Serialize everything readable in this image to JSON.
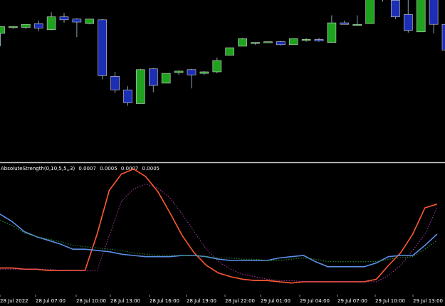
{
  "colors": {
    "background": "#000000",
    "bull": "#1fa31f",
    "bear": "#1c2fb4",
    "wick": "#8aa0b0",
    "separator": "#c8c8c8",
    "strength_line": "#ff5a32",
    "strength_signal": "#b03aa8",
    "weakness_line": "#5b8fe8",
    "weakness_signal": "#2f9a2f",
    "text": "#ffffff"
  },
  "indicator": {
    "name": "AbsoluteStrength(0,10,5,5,,3)",
    "values": [
      "0.0007",
      "0.0005",
      "0.0007",
      "0.0005"
    ]
  },
  "time_labels": [
    "28 Jul 2022",
    "28 Jul 07:00",
    "28 Jul 10:00",
    "28 Jul 13:00",
    "28 Jul 16:00",
    "28 Jul 19:00",
    "28 Jul 22:00",
    "29 Jul 01:00",
    "29 Jul 04:00",
    "29 Jul 07:00",
    "29 Jul 10:00",
    "29 Jul 13:00"
  ],
  "chart_data": [
    {
      "type": "candlestick",
      "price_range": [
        0,
        100
      ],
      "grid": false,
      "candles": [
        {
          "o": 43,
          "h": 52,
          "l": 26,
          "c": 52
        },
        {
          "o": 51,
          "h": 52,
          "l": 49,
          "c": 52
        },
        {
          "o": 51,
          "h": 54,
          "l": 49,
          "c": 55
        },
        {
          "o": 56,
          "h": 60,
          "l": 46,
          "c": 50
        },
        {
          "o": 48,
          "h": 71,
          "l": 47,
          "c": 65
        },
        {
          "o": 65,
          "h": 70,
          "l": 57,
          "c": 61
        },
        {
          "o": 62,
          "h": 63,
          "l": 38,
          "c": 58
        },
        {
          "o": 56,
          "h": 62,
          "l": 55,
          "c": 62
        },
        {
          "o": 61,
          "h": 62,
          "l": -18,
          "c": -13
        },
        {
          "o": -14,
          "h": -8,
          "l": -36,
          "c": -32
        },
        {
          "o": -32,
          "h": -27,
          "l": -53,
          "c": -49
        },
        {
          "o": -50,
          "h": -4,
          "l": -50,
          "c": -5
        },
        {
          "o": -4,
          "h": -3,
          "l": -35,
          "c": -26
        },
        {
          "o": -23,
          "h": -10,
          "l": -23,
          "c": -10
        },
        {
          "o": -9,
          "h": -6,
          "l": -12,
          "c": -7
        },
        {
          "o": -5,
          "h": -4,
          "l": -30,
          "c": -12
        },
        {
          "o": -10,
          "h": -7,
          "l": -12,
          "c": -8
        },
        {
          "o": -8,
          "h": 11,
          "l": -10,
          "c": 7
        },
        {
          "o": 14,
          "h": 24,
          "l": 14,
          "c": 24
        },
        {
          "o": 26,
          "h": 37,
          "l": 26,
          "c": 36
        },
        {
          "o": 30,
          "h": 31,
          "l": 28,
          "c": 31
        },
        {
          "o": 31,
          "h": 32,
          "l": 30,
          "c": 32
        },
        {
          "o": 32,
          "h": 33,
          "l": 27,
          "c": 28
        },
        {
          "o": 28,
          "h": 36,
          "l": 28,
          "c": 36
        },
        {
          "o": 34,
          "h": 37,
          "l": 32,
          "c": 35
        },
        {
          "o": 35,
          "h": 37,
          "l": 32,
          "c": 33
        },
        {
          "o": 31,
          "h": 67,
          "l": 31,
          "c": 57
        },
        {
          "o": 57,
          "h": 60,
          "l": 55,
          "c": 55
        },
        {
          "o": 55,
          "h": 67,
          "l": 53,
          "c": 55
        },
        {
          "o": 56,
          "h": 100,
          "l": 56,
          "c": 98
        },
        {
          "o": 98,
          "h": 100,
          "l": 85,
          "c": 89
        },
        {
          "o": 87,
          "h": 87,
          "l": 62,
          "c": 65
        },
        {
          "o": 68,
          "h": 90,
          "l": 44,
          "c": 47
        },
        {
          "o": 45,
          "h": 97,
          "l": 45,
          "c": 95
        },
        {
          "o": 95,
          "h": 95,
          "l": 43,
          "c": 55
        },
        {
          "o": 55,
          "h": 55,
          "l": 20,
          "c": 21
        }
      ]
    },
    {
      "type": "line",
      "title": "AbsoluteStrength(0,10,5,5,,3)",
      "ylim": [
        0,
        100
      ],
      "grid": false,
      "x": [
        0,
        1,
        2,
        3,
        4,
        5,
        6,
        7,
        8,
        9,
        10,
        11,
        12,
        13,
        14,
        15,
        16,
        17,
        18,
        19,
        20,
        21,
        22,
        23,
        24,
        25,
        26,
        27,
        28,
        29,
        30,
        31,
        32,
        33,
        34,
        35,
        36
      ],
      "series": [
        {
          "values": [
            19,
            19,
            18,
            18,
            17,
            17,
            17,
            17,
            46,
            81,
            94,
            98,
            92,
            80,
            63,
            45,
            31,
            21,
            15,
            12,
            10,
            9,
            9,
            8,
            7,
            8,
            8,
            8,
            8,
            8,
            8,
            10,
            21,
            31,
            46,
            67,
            70
          ],
          "style": "solid",
          "color": "#ff5a32"
        },
        {
          "values": [
            18,
            18,
            18,
            18,
            18,
            17,
            17,
            17,
            17,
            45,
            72,
            82,
            86,
            83,
            75,
            62,
            48,
            34,
            24,
            18,
            14,
            12,
            10,
            9,
            9,
            8,
            8,
            8,
            8,
            8,
            8,
            8,
            13,
            21,
            33,
            46,
            67
          ],
          "style": "dotted",
          "color": "#b03aa8"
        },
        {
          "values": [
            62,
            56,
            48,
            44,
            41,
            38,
            34,
            34,
            33,
            32,
            30,
            29,
            28,
            28,
            28,
            29,
            29,
            28,
            26,
            25,
            25,
            25,
            25,
            27,
            28,
            29,
            24,
            20,
            20,
            20,
            20,
            23,
            28,
            29,
            29,
            37,
            46
          ],
          "style": "solid",
          "color": "#5b8fe8"
        },
        {
          "values": [
            57,
            53,
            47,
            44,
            42,
            40,
            37,
            36,
            35,
            34,
            33,
            31,
            30,
            29,
            29,
            29,
            29,
            28,
            27,
            27,
            26,
            26,
            25,
            25,
            26,
            27,
            26,
            24,
            24,
            24,
            24,
            24,
            26,
            27,
            28,
            34,
            41
          ],
          "style": "dotted",
          "color": "#2f9a2f"
        }
      ]
    }
  ]
}
